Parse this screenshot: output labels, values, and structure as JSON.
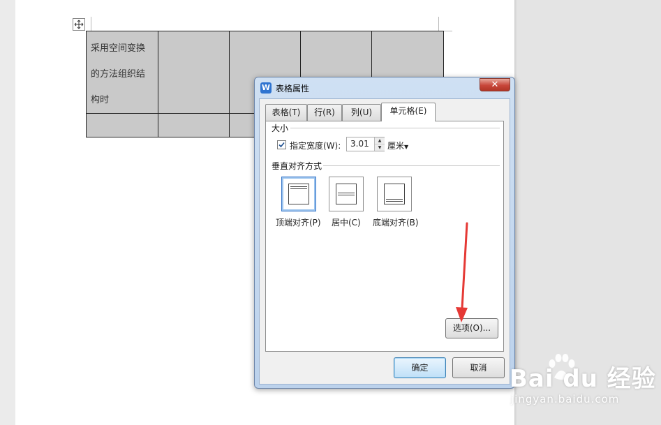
{
  "document": {
    "table_cell_text": [
      "采用空间变换",
      "的方法组织结",
      "构时"
    ]
  },
  "dialog": {
    "icon_letter": "W",
    "title": "表格属性",
    "close_symbol": "✕",
    "tabs": [
      {
        "label": "表格(T)"
      },
      {
        "label": "行(R)"
      },
      {
        "label": "列(U)"
      },
      {
        "label": "单元格(E)",
        "active": true
      }
    ],
    "size_group": {
      "label": "大小",
      "specify_width_checked": true,
      "specify_width_label": "指定宽度(W):",
      "width_value": "3.01",
      "unit": "厘米"
    },
    "valign_group": {
      "label": "垂直对齐方式",
      "options": [
        {
          "label": "顶端对齐(P)",
          "selected": true
        },
        {
          "label": "居中(C)",
          "selected": false
        },
        {
          "label": "底端对齐(B)",
          "selected": false
        }
      ]
    },
    "options_button": "选项(O)...",
    "ok_button": "确定",
    "cancel_button": "取消"
  },
  "watermark": {
    "brand": "Bai du 经验",
    "url": "jingyan.baidu.com"
  },
  "colors": {
    "table_fill": "#c9c9c9",
    "arrow": "#e53935",
    "title_icon": "#2f74d0"
  }
}
